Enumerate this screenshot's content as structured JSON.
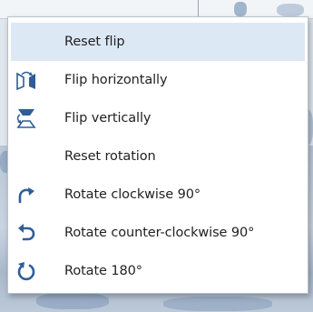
{
  "colors": {
    "menu_background": "#ffffff",
    "highlight": "#dde8f5",
    "icon_blue": "#2f5d9a",
    "text": "#222222"
  },
  "menu": {
    "items": [
      {
        "label": "Reset flip",
        "icon": "none",
        "highlighted": true
      },
      {
        "label": "Flip horizontally",
        "icon": "flip-horizontal-icon",
        "highlighted": false
      },
      {
        "label": "Flip vertically",
        "icon": "flip-vertical-icon",
        "highlighted": false
      },
      {
        "label": "Reset rotation",
        "icon": "none",
        "highlighted": false
      },
      {
        "label": "Rotate clockwise 90°",
        "icon": "rotate-clockwise-icon",
        "highlighted": false
      },
      {
        "label": "Rotate counter-clockwise 90°",
        "icon": "rotate-counter-clockwise-icon",
        "highlighted": false
      },
      {
        "label": "Rotate 180°",
        "icon": "rotate-180-icon",
        "highlighted": false
      }
    ]
  }
}
